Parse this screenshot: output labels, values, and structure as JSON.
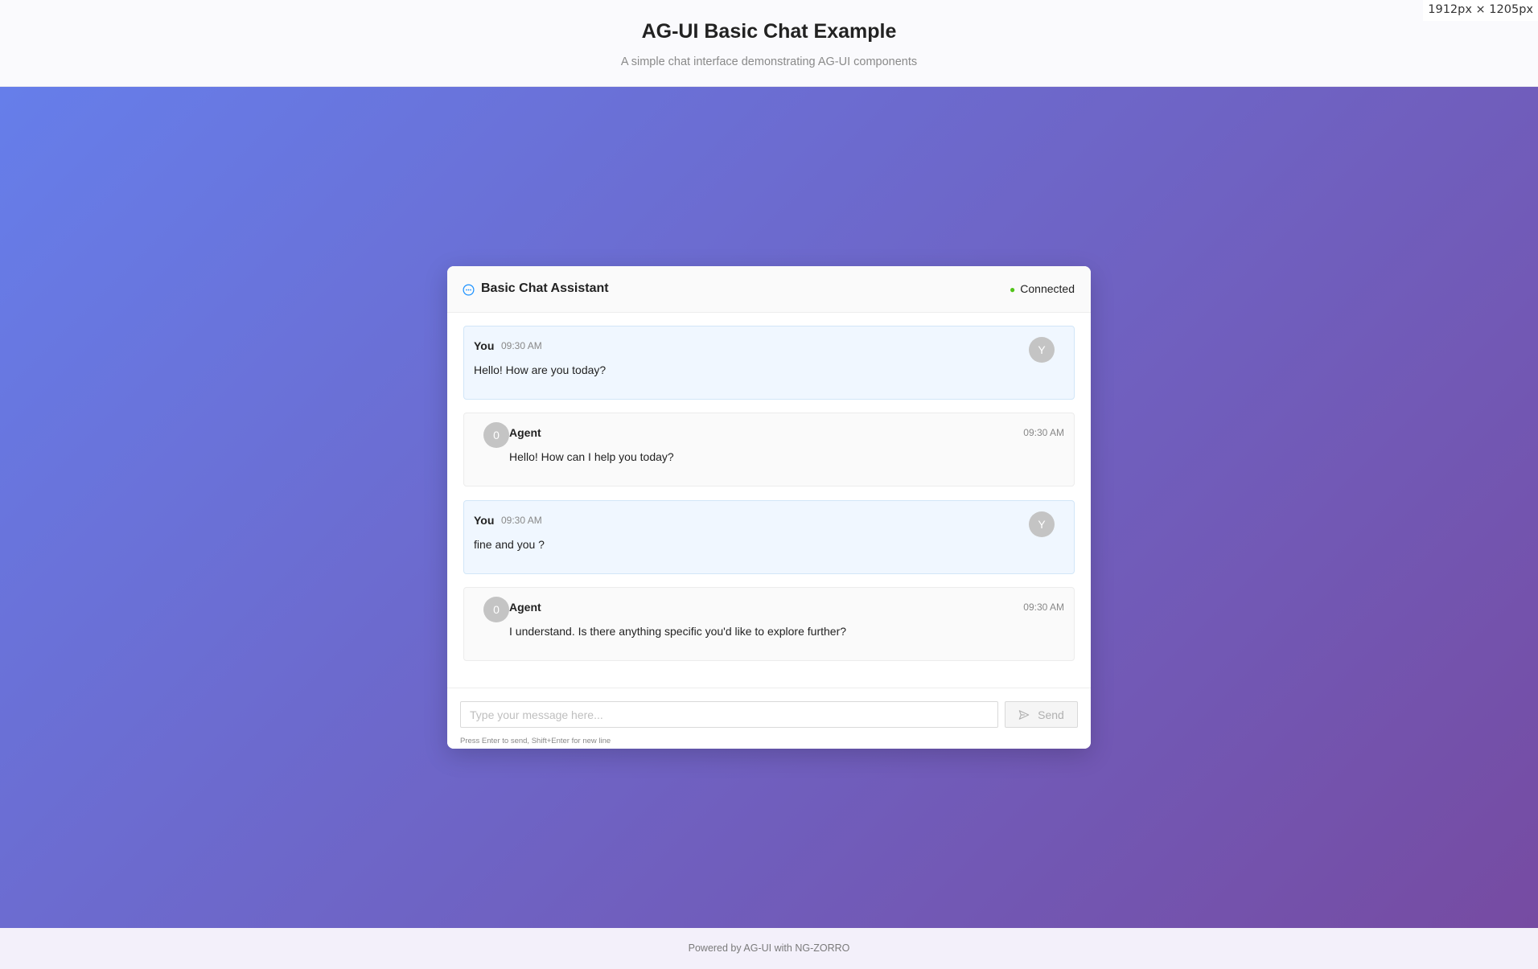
{
  "page": {
    "title": "AG-UI Basic Chat Example",
    "subtitle": "A simple chat interface demonstrating AG-UI components",
    "size_readout": "1912px × 1205px",
    "footer": "Powered by AG-UI with NG-ZORRO"
  },
  "chat": {
    "title": "Basic Chat Assistant",
    "header_icon": "message-icon",
    "status": "Connected",
    "status_color": "#52c41a"
  },
  "messages": [
    {
      "role": "user",
      "author": "You",
      "time": "09:30 AM",
      "text": "Hello! How are you today?",
      "avatar": "Y"
    },
    {
      "role": "agent",
      "author": "Agent",
      "time": "09:30 AM",
      "text": "Hello! How can I help you today?",
      "avatar": "0"
    },
    {
      "role": "user",
      "author": "You",
      "time": "09:30 AM",
      "text": "fine and you ?",
      "avatar": "Y"
    },
    {
      "role": "agent",
      "author": "Agent",
      "time": "09:30 AM",
      "text": "I understand. Is there anything specific you'd like to explore further?",
      "avatar": "0"
    }
  ],
  "composer": {
    "placeholder": "Type your message here...",
    "value": "",
    "send_label": "Send",
    "send_icon": "send-icon",
    "hint": "Press Enter to send, Shift+Enter for new line"
  },
  "colors": {
    "gradient_start": "#667eea",
    "gradient_end": "#764ba2",
    "user_bubble": "#f0f7ff",
    "agent_bubble": "#fafafa",
    "chat_icon": "#1890ff"
  }
}
